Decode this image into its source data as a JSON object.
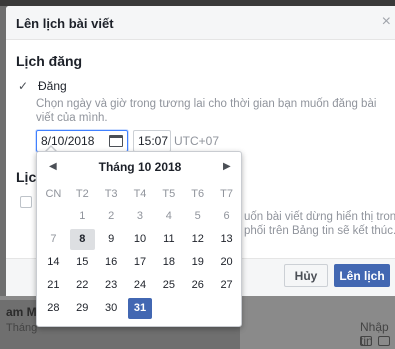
{
  "background": {
    "text1": "am M",
    "text2": "Tháng",
    "text3": "Nhập tin"
  },
  "dialog": {
    "title": "Lên lịch bài viết",
    "close": "×",
    "section_title": "Lịch đăng",
    "publish": {
      "checked_glyph": "✓",
      "label": "Đăng",
      "hint": "Chọn ngày và giờ trong tương lai cho thời gian bạn muốn đăng bài viết của mình."
    },
    "date_value": "8/10/2018",
    "time_value": "15:07",
    "timezone": "UTC+07",
    "section2_title_partial": "Lịc",
    "hint2": "uốn bài viết dừng hiển thị trong phối trên Bảng tin sẽ kết thúc.",
    "cancel_label": "Hủy",
    "schedule_label": "Lên lịch"
  },
  "calendar": {
    "month_label": "Tháng 10 2018",
    "prev_glyph": "◀",
    "next_glyph": "▶",
    "weekdays": [
      "CN",
      "T2",
      "T3",
      "T4",
      "T5",
      "T6",
      "T7"
    ],
    "leading_empty": 1,
    "days": [
      {
        "d": "1",
        "state": "disabled"
      },
      {
        "d": "2",
        "state": "disabled"
      },
      {
        "d": "3",
        "state": "disabled"
      },
      {
        "d": "4",
        "state": "disabled"
      },
      {
        "d": "5",
        "state": "disabled"
      },
      {
        "d": "6",
        "state": "disabled"
      },
      {
        "d": "7",
        "state": "disabled"
      },
      {
        "d": "8",
        "state": "today"
      },
      {
        "d": "9",
        "state": "normal"
      },
      {
        "d": "10",
        "state": "normal"
      },
      {
        "d": "11",
        "state": "normal"
      },
      {
        "d": "12",
        "state": "normal"
      },
      {
        "d": "13",
        "state": "normal"
      },
      {
        "d": "14",
        "state": "normal"
      },
      {
        "d": "15",
        "state": "normal"
      },
      {
        "d": "16",
        "state": "normal"
      },
      {
        "d": "17",
        "state": "normal"
      },
      {
        "d": "18",
        "state": "normal"
      },
      {
        "d": "19",
        "state": "normal"
      },
      {
        "d": "20",
        "state": "normal"
      },
      {
        "d": "21",
        "state": "normal"
      },
      {
        "d": "22",
        "state": "normal"
      },
      {
        "d": "23",
        "state": "normal"
      },
      {
        "d": "24",
        "state": "normal"
      },
      {
        "d": "25",
        "state": "normal"
      },
      {
        "d": "26",
        "state": "normal"
      },
      {
        "d": "27",
        "state": "normal"
      },
      {
        "d": "28",
        "state": "normal"
      },
      {
        "d": "29",
        "state": "normal"
      },
      {
        "d": "30",
        "state": "normal"
      },
      {
        "d": "31",
        "state": "selected"
      }
    ]
  },
  "colors": {
    "accent": "#4267b2",
    "focus_border": "#4080ff",
    "muted_text": "#90949c"
  }
}
